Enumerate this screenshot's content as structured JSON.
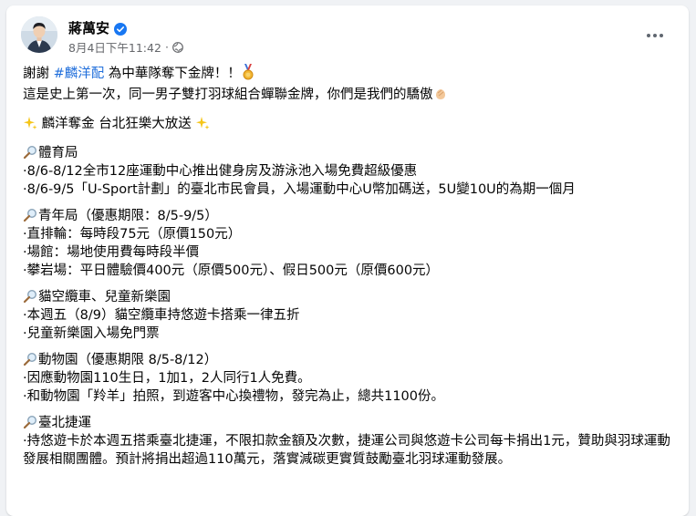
{
  "post": {
    "author": "蔣萬安",
    "timestamp": "8月4日下午11:42",
    "dot": "·",
    "more_label": "⋯"
  },
  "content": {
    "p1_prefix": "謝謝 ",
    "hashtag": "#麟洋配",
    "p1_suffix": " 為中華隊奪下金牌！！",
    "p1_line2": "這是史上第一次，同一男子雙打羽球組合蟬聯金牌，你們是我們的驕傲",
    "highlight": "麟洋奪金 台北狂樂大放送",
    "sections": [
      {
        "title": "體育局",
        "items": [
          "·8/6-8/12全市12座運動中心推出健身房及游泳池入場免費超級優惠",
          "·8/6-9/5「U-Sport計劃」的臺北市民會員，入場運動中心U幣加碼送，5U變10U的為期一個月"
        ]
      },
      {
        "title": "青年局（優惠期限：8/5-9/5）",
        "items": [
          "·直排輪：每時段75元（原價150元）",
          "·場館：場地使用費每時段半價",
          "·攀岩場：平日體驗價400元（原價500元）、假日500元（原價600元）"
        ]
      },
      {
        "title": "貓空纜車、兒童新樂園",
        "items": [
          "·本週五（8/9）貓空纜車持悠遊卡搭乘一律五折",
          "·兒童新樂園入場免門票"
        ]
      },
      {
        "title": "動物園（優惠期限 8/5-8/12）",
        "items": [
          "·因應動物園110生日，1加1，2人同行1人免費。",
          "·和動物園「羚羊」拍照，到遊客中心換禮物，發完為止，總共1100份。"
        ]
      },
      {
        "title": "臺北捷運",
        "items": [
          "·持悠遊卡於本週五搭乘臺北捷運，不限扣款金額及次數，捷運公司與悠遊卡公司每卡捐出1元，贊助與羽球運動發展相關團體。預計將捐出超過110萬元，落實減碳更實質鼓勵臺北羽球運動發展。"
        ]
      }
    ]
  },
  "colors": {
    "hashtag": "#216fdb",
    "verified": "#1877f2",
    "meta": "#65676b"
  },
  "icons": [
    "verified-badge-icon",
    "globe-icon",
    "more-options-icon",
    "medal-icon",
    "clap-icon",
    "sparkles-icon",
    "magnifier-icon"
  ]
}
